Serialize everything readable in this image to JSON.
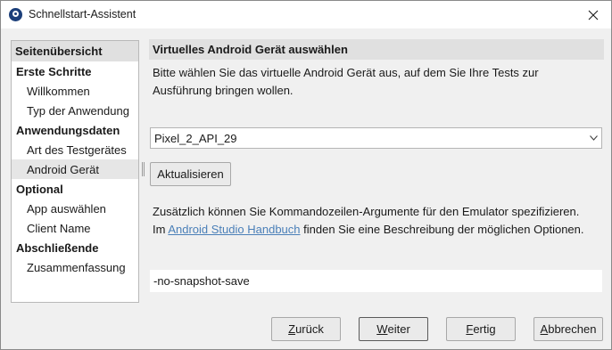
{
  "window": {
    "title": "Schnellstart-Assistent"
  },
  "sidebar": {
    "header": "Seitenübersicht",
    "sections": [
      {
        "label": "Erste Schritte",
        "items": [
          "Willkommen",
          "Typ der Anwendung"
        ]
      },
      {
        "label": "Anwendungsdaten",
        "items": [
          "Art des Testgerätes",
          "Android Gerät"
        ]
      },
      {
        "label": "Optional",
        "items": [
          "App auswählen",
          "Client Name"
        ]
      },
      {
        "label": "Abschließende",
        "items": [
          "Zusammenfassung"
        ]
      }
    ],
    "selected_item": "Android Gerät"
  },
  "panel": {
    "title": "Virtuelles Android Gerät auswählen",
    "intro": "Bitte wählen Sie das virtuelle Android Gerät aus, auf dem Sie Ihre Tests zur Ausführung bringen wollen.",
    "device_select_value": "Pixel_2_API_29",
    "refresh_label": "Aktualisieren",
    "extra_text_before": "Zusätzlich können Sie Kommandozeilen-Argumente für den Emulator spezifizieren. Im ",
    "extra_link": "Android Studio Handbuch",
    "extra_text_after": " finden Sie eine Beschreibung der möglichen Optionen.",
    "emulator_args_value": "-no-snapshot-save"
  },
  "footer": {
    "back": {
      "mnemonic": "Z",
      "rest": "urück"
    },
    "next": {
      "mnemonic": "W",
      "rest": "eiter"
    },
    "finish": {
      "mnemonic": "F",
      "rest": "ertig"
    },
    "cancel": {
      "mnemonic": "A",
      "rest": "bbrechen"
    }
  },
  "icons": {
    "app": "app-logo-icon",
    "close": "close-icon",
    "dropdown": "chevron-down-icon"
  }
}
